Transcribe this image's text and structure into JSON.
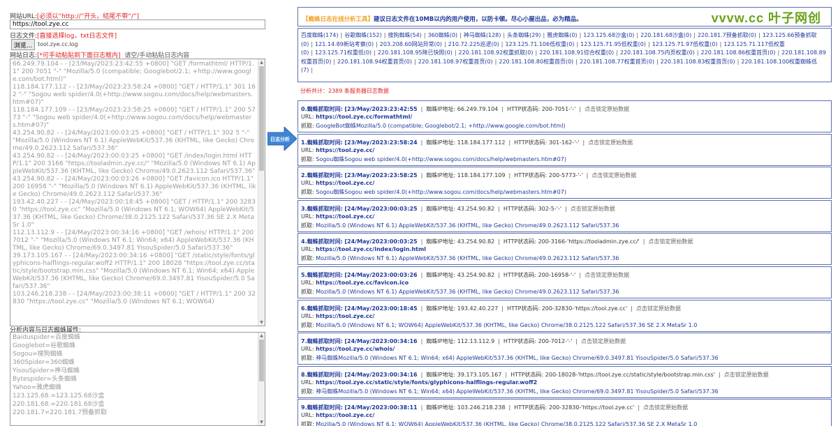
{
  "left": {
    "url_label": "网站URL:",
    "url_hint": "[必须以“http://”开头，结尾不带“/”]",
    "url_value": "https://tool.zye.cc",
    "file_label": "日志文件:",
    "file_hint": "[直接选择log，txt日志文件]",
    "browse_label": "浏览...",
    "file_name": "tool.zye.cc.log",
    "log_label": "网站日志:",
    "log_hint": "[*可手动粘贴到下面日志框内]",
    "log_hint2": "请空/手动粘贴日志内容",
    "log_content": "66.249.79.104 - - [23/May/2023:23:42:55 +0800] \"GET /formathtml/ HTTP/1.1\" 200 7051 \"-\" \"Mozilla/5.0 (compatible; Googlebot/2.1; +http://www.google.com/bot.html)\"\n118.184.177.112 - - [23/May/2023:23:58:24 +0800] \"GET / HTTP/1.1\" 301 162 \"-\" \"Sogou web spider/4.0(+http://www.sogou.com/docs/help/webmasters.htm#07)\"\n118.184.177.109 - - [23/May/2023:23:58:25 +0800] \"GET / HTTP/1.1\" 200 5773 \"-\" \"Sogou web spider/4.0(+http://www.sogou.com/docs/help/webmasters.htm#07)\"\n43.254.90.82 - - [24/May/2023:00:03:25 +0800] \"GET / HTTP/1.1\" 302 5 \"-\" \"Mozilla/5.0 (Windows NT 6.1) AppleWebKit/537.36 (KHTML, like Gecko) Chrome/49.0.2623.112 Safari/537.36\"\n43.254.90.82 - - [24/May/2023:00:03:25 +0800] \"GET /index/login.html HTTP/1.1\" 200 3166 \"https://tooladmin.zye.cc/\" \"Mozilla/5.0 (Windows NT 6.1) AppleWebKit/537.36 (KHTML, like Gecko) Chrome/49.0.2623.112 Safari/537.36\"\n43.254.90.82 - - [24/May/2023:00:03:26 +0800] \"GET /favicon.ico HTTP/1.1\" 200 16958 \"-\" \"Mozilla/5.0 (Windows NT 6.1) AppleWebKit/537.36 (KHTML, like Gecko) Chrome/49.0.2623.112 Safari/537.36\"\n193.42.40.227 - - [24/May/2023:00:18:45 +0800] \"GET / HTTP/1.1\" 200 32830 \"https://tool.zye.cc\" \"Mozilla/5.0 (Windows NT 6.1; WOW64) AppleWebKit/537.36 (KHTML, like Gecko) Chrome/38.0.2125.122 Safari/537.36 SE 2.X MetaSr 1.0\"\n112.13.112.9 - - [24/May/2023:00:34:16 +0800] \"GET /whois/ HTTP/1.1\" 200 7012 \"-\" \"Mozilla/5.0 (Windows NT 6.1; Win64; x64) AppleWebKit/537.36 (KHTML, like Gecko) Chrome/69.0.3497.81 YisouSpider/5.0 Safari/537.36\"\n39.173.105.167 - - [24/May/2023:00:34:16 +0800] \"GET /static/style/fonts/glyphicons-halflings-regular.woff2 HTTP/1.1\" 200 18028 \"https://tool.zye.cc/static/style/bootstrap.min.css\" \"Mozilla/5.0 (Windows NT 6.1; Win64; x64) AppleWebKit/537.36 (KHTML, like Gecko) Chrome/69.0.3497.81 YisouSpider/5.0 Safari/537.36\"\n103.246.218.238 - - [24/May/2023:00:38:11 +0800] \"GET / HTTP/1.1\" 200 32830 \"https://tool.zye.cc\" \"Mozilla/5.0 (Windows NT 6.1; WOW64)",
    "attr_label": "分析内容与日志蜘蛛属性:",
    "attr_content": "Baiduspider=百度蜘蛛\nGooglebot=谷歌蜘蛛\nSogou=搜狗蜘蛛\n360Spider=360蜘蛛\nYisouSpider=神马蜘蛛\nBytespider=头条蜘蛛\nYahoo=雅虎蜘蛛\n123.125.68.=123.125.68沙盒\n220.181.68.=220.181.68沙盒\n220.181.7=220.181.7预备抓取"
  },
  "analyze_label": "日志分析",
  "header": {
    "tool_name": "【蜘蛛日志在线分析工具】",
    "note": "建议日志文件在10MB以内的用户使用，以防卡顿。尽心小屋出品，必为精品。",
    "brand": "vvvw.cc 叶子网创"
  },
  "spiders": [
    "百度蜘蛛(174)",
    "谷歌蜘蛛(152)",
    "搜狗蜘蛛(54)",
    "360蜘蛛(0)",
    "神马蜘蛛(128)",
    "头条蜘蛛(29)",
    "雅虎蜘蛛(0)",
    "123.125.68沙盒(0)",
    "220.181.68沙盒(0)",
    "220.181.7预备抓取(0)",
    "123.125.66预备抓取(0)",
    "121.14.89新站考察(0)",
    "203.208.60网站异常(0)",
    "210.72.225巡逻(0)",
    "123.125.71.106低权重(0)",
    "123.125.71.95低权重(0)",
    "123.125.71.97低权重(0)",
    "123.125.71.117低权重(0)",
    "123.125.71权重低(0)",
    "220.181.108.95降已快照(0)",
    "220.181.108.92权重抓取(0)",
    "220.181.108.91综合权重(0)",
    "220.181.108.75内页权重(0)",
    "220.181.108.86权重首页(0)",
    "220.181.108.89权重首页(0)",
    "220.181.108.94权重首页(0)",
    "220.181.108.97权重首页(0)",
    "220.181.108.80权重首页(0)",
    "220.181.108.77权重首页(0)",
    "220.181.108.83权重首页(0)",
    "220.181.108.100权重蜘蛛低(7)"
  ],
  "total_text": "分析共计：2389 条服务器日志数据",
  "entry_labels": {
    "time": "蜘蛛抓取时间:",
    "ip": "蜘蛛IP地址:",
    "status": "HTTP状态码:",
    "click": "点击锁定原始数据",
    "url": "URL:",
    "agent": "抓取:"
  },
  "entries": [
    {
      "idx": "0.",
      "time": "[23/May/2023:23:42:55",
      "ip": "66.249.79.104",
      "status": "200-7051-'-'",
      "url": "https://tool.zye.cc/formathtml/",
      "agent": "GoogleBot蜘蛛Mozilla/5.0 (compatible; Googlebot/2.1; +http://www.google.com/bot.html)"
    },
    {
      "idx": "1.",
      "time": "[23/May/2023:23:58:24",
      "ip": "118.184.177.112",
      "status": "301-162-'-'",
      "url": "https://tool.zye.cc/",
      "agent": "Sogou蜘蛛Sogou web spider/4.0(+http://www.sogou.com/docs/help/webmasters.htm#07)"
    },
    {
      "idx": "2.",
      "time": "[23/May/2023:23:58:25",
      "ip": "118.184.177.109",
      "status": "200-5773-'-'",
      "url": "https://tool.zye.cc/",
      "agent": "Sogou蜘蛛Sogou web spider/4.0(+http://www.sogou.com/docs/help/webmasters.htm#07)"
    },
    {
      "idx": "3.",
      "time": "[24/May/2023:00:03:25",
      "ip": "43.254.90.82",
      "status": "302-5-'-'",
      "url": "https://tool.zye.cc/",
      "agent": "Mozilla/5.0 (Windows NT 6.1) AppleWebKit/537.36 (KHTML, like Gecko) Chrome/49.0.2623.112 Safari/537.36"
    },
    {
      "idx": "4.",
      "time": "[24/May/2023:00:03:25",
      "ip": "43.254.90.82",
      "status": "200-3166-'https://tooladmin.zye.cc/'",
      "url": "https://tool.zye.cc/index/login.html",
      "agent": "Mozilla/5.0 (Windows NT 6.1) AppleWebKit/537.36 (KHTML, like Gecko) Chrome/49.0.2623.112 Safari/537.36"
    },
    {
      "idx": "5.",
      "time": "[24/May/2023:00:03:26",
      "ip": "43.254.90.82",
      "status": "200-16958-'-'",
      "url": "https://tool.zye.cc/favicon.ico",
      "agent": "Mozilla/5.0 (Windows NT 6.1) AppleWebKit/537.36 (KHTML, like Gecko) Chrome/49.0.2623.112 Safari/537.36"
    },
    {
      "idx": "6.",
      "time": "[24/May/2023:00:18:45",
      "ip": "193.42.40.227",
      "status": "200-32830-'https://tool.zye.cc'",
      "url": "https://tool.zye.cc/",
      "agent": "Mozilla/5.0 (Windows NT 6.1; WOW64) AppleWebKit/537.36 (KHTML, like Gecko) Chrome/38.0.2125.122 Safari/537.36 SE 2.X MetaSr 1.0"
    },
    {
      "idx": "7.",
      "time": "[24/May/2023:00:34:16",
      "ip": "112.13.112.9",
      "status": "200-7012-'-'",
      "url": "https://tool.zye.cc/whois/",
      "agent": "神马蜘蛛Mozilla/5.0 (Windows NT 6.1; Win64; x64) AppleWebKit/537.36 (KHTML, like Gecko) Chrome/69.0.3497.81 YisouSpider/5.0 Safari/537.36"
    },
    {
      "idx": "8.",
      "time": "[24/May/2023:00:34:16",
      "ip": "39.173.105.167",
      "status": "200-18028-'https://tool.zye.cc/static/style/bootstrap.min.css'",
      "url": "https://tool.zye.cc/static/style/fonts/glyphicons-halflings-regular.woff2",
      "agent": "神马蜘蛛Mozilla/5.0 (Windows NT 6.1; Win64; x64) AppleWebKit/537.36 (KHTML, like Gecko) Chrome/69.0.3497.81 YisouSpider/5.0 Safari/537.36"
    },
    {
      "idx": "9.",
      "time": "[24/May/2023:00:38:11",
      "ip": "103.246.218.238",
      "status": "200-32830-'https://tool.zye.cc'",
      "url": "https://tool.zye.cc/",
      "agent": "Mozilla/5.0 (Windows NT 6.1; WOW64) AppleWebKit/537.36 (KHTML, like Gecko) Chrome/38.0.2125.122 Safari/537.36 SE 2.X MetaSr 1.0"
    }
  ],
  "colors": {
    "accent_blue": "#1f3a9a",
    "hint_red": "#e21d1d",
    "brand_green": "#6aa21a",
    "arrow_blue": "#3f86d6"
  }
}
